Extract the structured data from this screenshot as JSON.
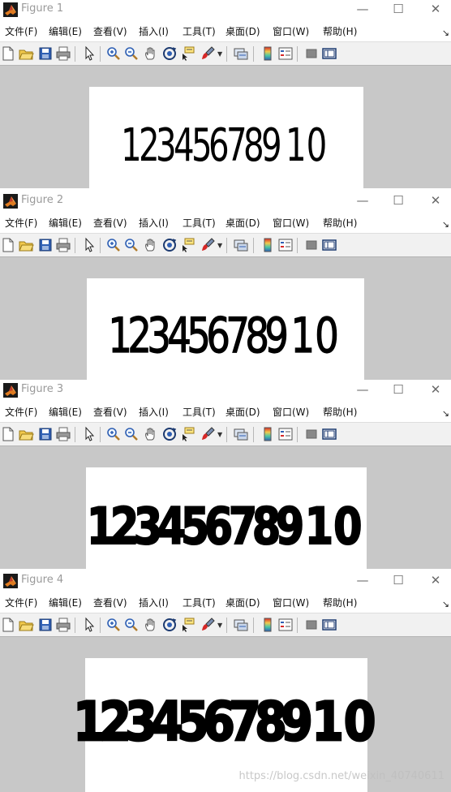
{
  "figures": [
    {
      "title": "Figure 1",
      "digits": [
        "1",
        "2",
        "3",
        "4",
        "5",
        "6",
        "7",
        "8",
        "9",
        "10"
      ]
    },
    {
      "title": "Figure 2",
      "digits": [
        "1",
        "2",
        "3",
        "4",
        "5",
        "6",
        "7",
        "8",
        "9",
        "10"
      ]
    },
    {
      "title": "Figure 3",
      "digits": [
        "1",
        "2",
        "3",
        "4",
        "5",
        "6",
        "7",
        "8",
        "9",
        "10"
      ]
    },
    {
      "title": "Figure 4",
      "digits": [
        "1",
        "2",
        "3",
        "4",
        "5",
        "6",
        "7",
        "8",
        "9",
        "10"
      ]
    }
  ],
  "menu": [
    "文件(F)",
    "编辑(E)",
    "查看(V)",
    "插入(I)",
    "工具(T)",
    "桌面(D)",
    "窗口(W)",
    "帮助(H)"
  ],
  "window_controls": {
    "minimize": "—",
    "maximize": "☐",
    "close": "✕"
  },
  "menu_overflow_arrow": "↘",
  "toolbar_icons": [
    "new-figure-icon",
    "open-icon",
    "save-icon",
    "print-icon",
    "edit-pointer-icon",
    "zoom-in-icon",
    "zoom-out-icon",
    "pan-icon",
    "rotate-3d-icon",
    "data-cursor-icon",
    "brush-icon",
    "link-plot-icon",
    "colorbar-icon",
    "legend-icon",
    "hide-plot-tools-icon",
    "show-plot-tools-icon"
  ],
  "digit_weight_level": [
    0.0,
    0.33,
    0.66,
    1.0
  ],
  "colors": {
    "figure_background": "#c8c8c8",
    "canvas": "#ffffff",
    "toolbar": "#f1f1f1",
    "title_text": "#9a9a9a"
  },
  "watermark": "https://blog.csdn.net/weixin_40740611"
}
